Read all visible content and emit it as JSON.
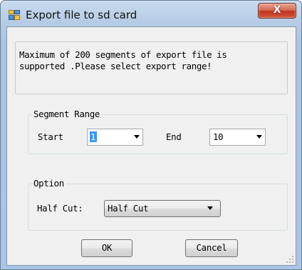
{
  "window": {
    "title": "Export file to sd card",
    "close_glyph": "X",
    "icon": "app-window-icon"
  },
  "message": "Maximum of 200 segments of export file is\nsupported .Please select export range!",
  "segment_range": {
    "legend": "Segment Range",
    "start_label": "Start",
    "start_value": "1",
    "end_label": "End",
    "end_value": "10"
  },
  "option": {
    "legend": "Option",
    "half_cut_label": "Half Cut:",
    "half_cut_value": "Half Cut"
  },
  "buttons": {
    "ok": "OK",
    "cancel": "Cancel"
  },
  "colors": {
    "close_button": "#c0321e",
    "selection": "#3399ff",
    "dialog_background": "#f0f0f0"
  }
}
